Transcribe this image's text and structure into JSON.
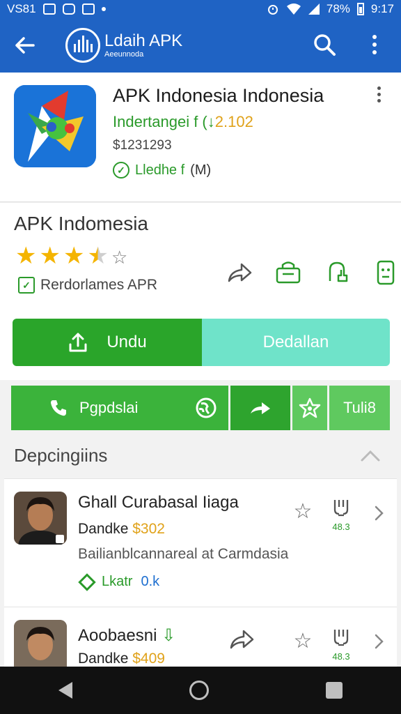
{
  "status_bar": {
    "left_text": "VS81",
    "battery_text": "78%",
    "time": "9:17"
  },
  "app_bar": {
    "brand_title": "Ldaih APK",
    "brand_subtitle": "Aeeunnoda"
  },
  "app": {
    "title": "APK Indonesia Indonesia",
    "meta_label": "Indertangei f (",
    "meta_version": "2.102",
    "price": "$1231293",
    "verified_label": "Lledhe f",
    "verified_extra": "(M)"
  },
  "info": {
    "title": "APK Indomesia",
    "rating_stars": 3.5,
    "rating_max": 5,
    "recommend_label": "Rerdorlames APR"
  },
  "actions": {
    "download_label": "Undu",
    "details_label": "Dedallan"
  },
  "toolbar2": {
    "call_label": "Pgpdslai",
    "write_label": "Tuli8"
  },
  "section": {
    "title": "Depcingiins"
  },
  "reviews": [
    {
      "name": "Ghall Curabasal Iiaga",
      "sub_label": "Dandke",
      "sub_price": "$302",
      "description": "Bailianblcannareal at Carmdasia",
      "tag_label": "Lkatr",
      "tag_number": "0.k",
      "download_count": "48.3"
    },
    {
      "name": "Aoobaesni",
      "sub_label": "Dandke",
      "sub_price": "$409",
      "download_count": "48.3"
    }
  ],
  "colors": {
    "app_bar": "#1f63c4",
    "primary_green": "#2aa52a",
    "details_teal": "#6fe3c9",
    "star_gold": "#f4b400",
    "price_orange": "#e0a21a"
  },
  "icons": [
    "back-arrow-icon",
    "search-icon",
    "more-vert-icon",
    "share-icon",
    "download-icon",
    "phone-icon",
    "globe-icon",
    "star-icon",
    "chevron-right-icon",
    "chevron-up-icon"
  ]
}
